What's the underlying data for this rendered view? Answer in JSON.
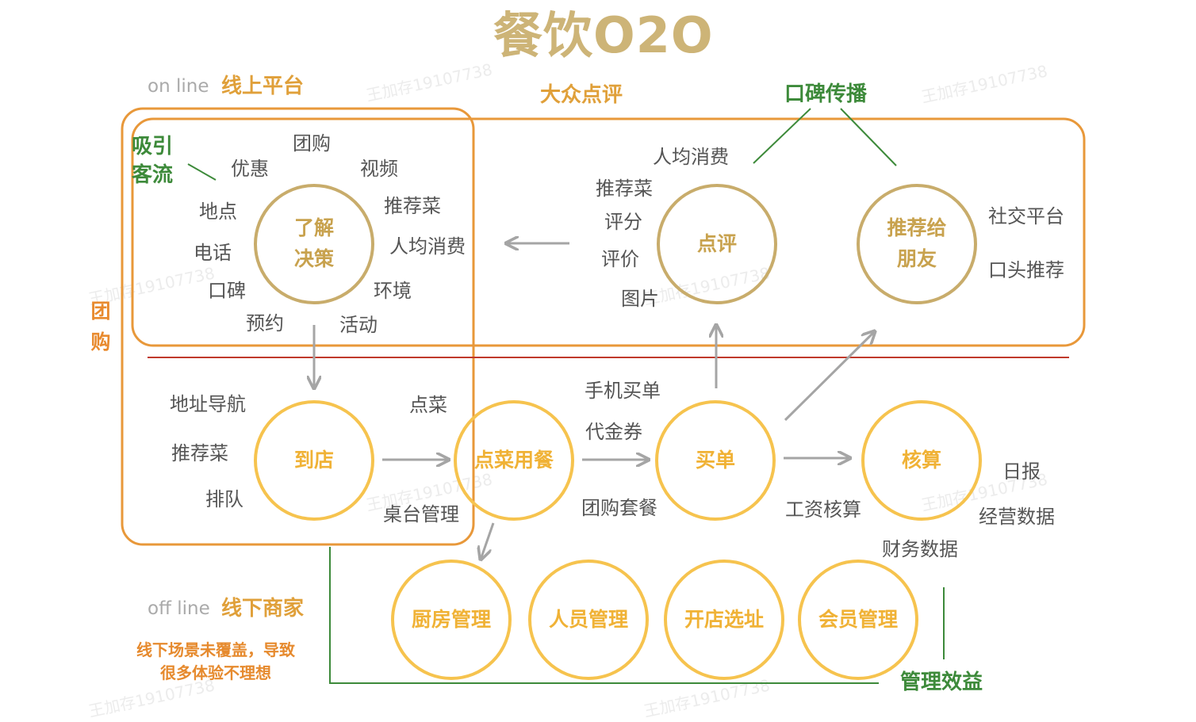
{
  "title": "餐饮O2O",
  "online": {
    "label_en": "on line",
    "label_cn": "线上平台"
  },
  "offline": {
    "label_en": "off line",
    "label_cn": "线下商家",
    "note": "线下场景未覆盖，导致很多体验不理想"
  },
  "groups": {
    "dianping": "大众点评",
    "tuangou": "团购"
  },
  "tags": {
    "attract_traffic": "吸引客流",
    "word_of_mouth": "口碑传播",
    "management_benefit": "管理效益"
  },
  "circles": {
    "understand": "了解决策",
    "review": "点评",
    "recommend": "推荐给朋友",
    "arrive": "到店",
    "order_dine": "点菜用餐",
    "pay": "买单",
    "accounting": "核算",
    "kitchen": "厨房管理",
    "staff": "人员管理",
    "site": "开店选址",
    "member": "会员管理"
  },
  "understand_items": [
    "团购",
    "优惠",
    "视频",
    "地点",
    "推荐菜",
    "电话",
    "人均消费",
    "口碑",
    "环境",
    "预约",
    "活动"
  ],
  "review_items": [
    "人均消费",
    "推荐菜",
    "评分",
    "评价",
    "图片"
  ],
  "recommend_items": [
    "社交平台",
    "口头推荐"
  ],
  "arrive_items": [
    "地址导航",
    "推荐菜",
    "排队"
  ],
  "order_items": [
    "点菜",
    "桌台管理"
  ],
  "pay_items": [
    "手机买单",
    "代金券",
    "团购套餐"
  ],
  "accounting_items": [
    "工资核算",
    "日报",
    "经营数据",
    "财务数据"
  ],
  "watermark": "王加存19107738",
  "colors": {
    "title": "#cdb477",
    "orange_box": "#e8983a",
    "gold_circle": "#c8ac6b",
    "yellow_circle": "#f6c34e",
    "green": "#3d8a3a",
    "divider": "#c0392b",
    "arrow": "#a5a5a5"
  }
}
